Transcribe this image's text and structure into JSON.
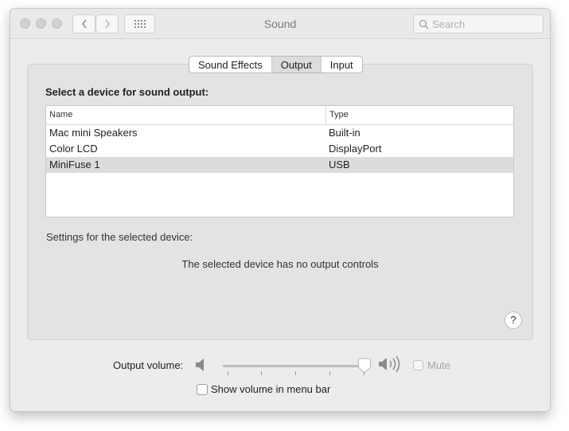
{
  "window": {
    "title": "Sound"
  },
  "search": {
    "placeholder": "Search"
  },
  "tabs": [
    {
      "label": "Sound Effects",
      "active": false
    },
    {
      "label": "Output",
      "active": true
    },
    {
      "label": "Input",
      "active": false
    }
  ],
  "output": {
    "heading": "Select a device for sound output:",
    "columns": [
      "Name",
      "Type"
    ],
    "devices": [
      {
        "name": "Mac mini Speakers",
        "type": "Built-in",
        "selected": false
      },
      {
        "name": "Color LCD",
        "type": "DisplayPort",
        "selected": false
      },
      {
        "name": "MiniFuse 1",
        "type": "USB",
        "selected": true
      }
    ],
    "settings_label": "Settings for the selected device:",
    "no_controls_message": "The selected device has no output controls",
    "help_label": "?"
  },
  "volume": {
    "label": "Output volume:",
    "level": 1.0,
    "mute_label": "Mute",
    "mute_checked": false,
    "show_in_menu_bar_label": "Show volume in menu bar",
    "show_in_menu_bar_checked": false
  },
  "colors": {
    "window_bg": "#ececec",
    "selected_row": "#dcdcdc"
  }
}
